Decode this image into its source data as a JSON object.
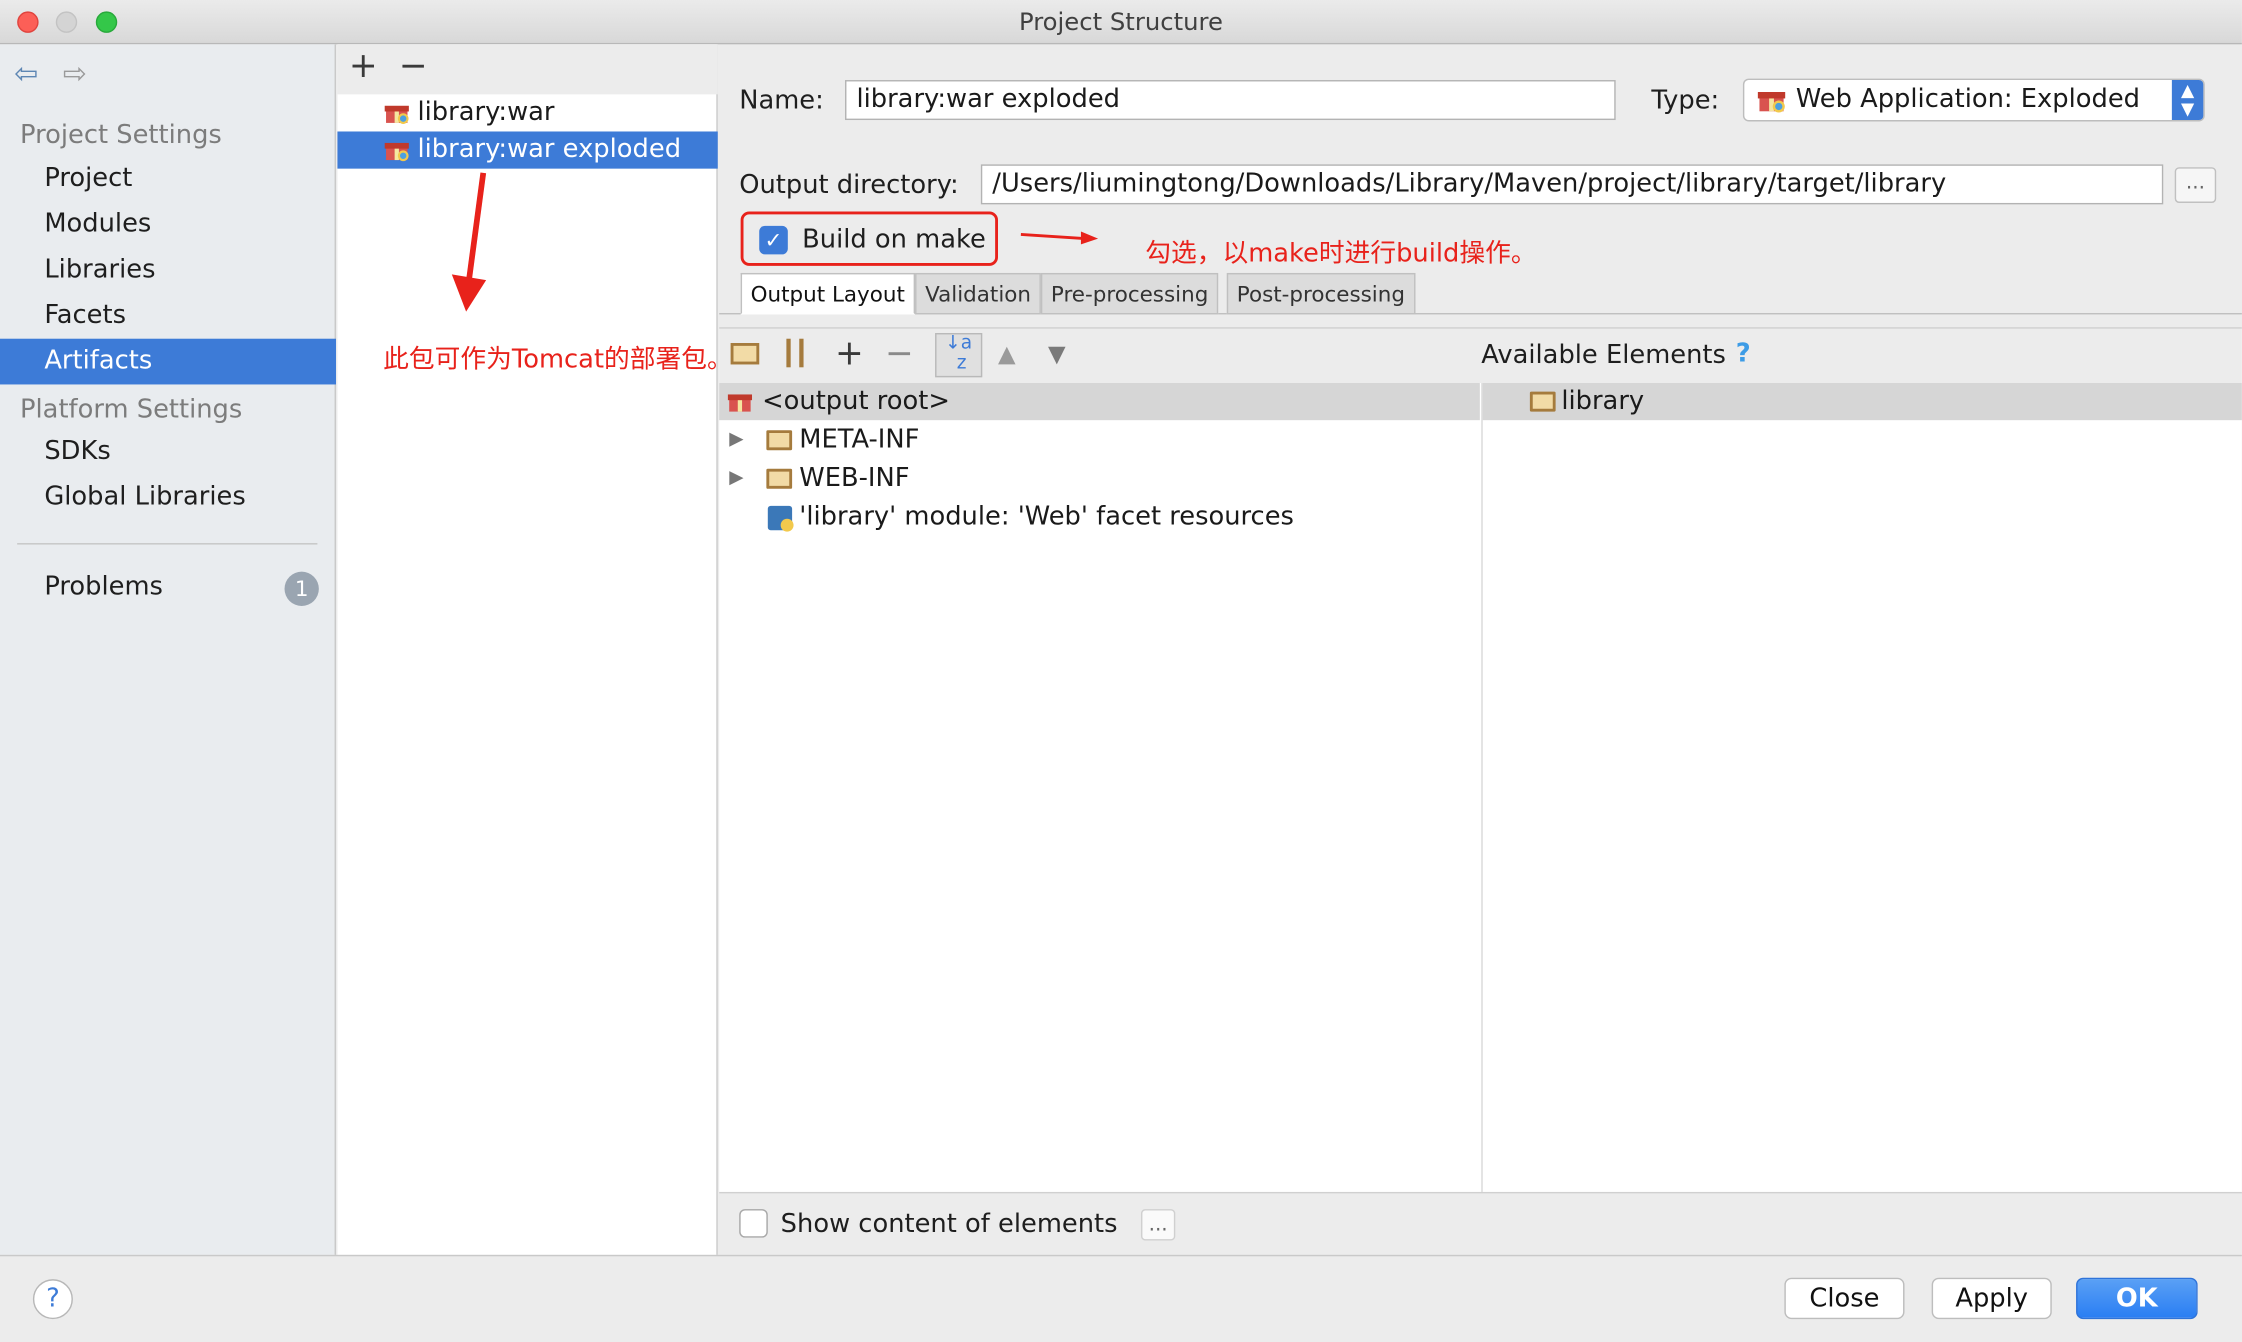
{
  "window": {
    "title": "Project Structure"
  },
  "sidebar": {
    "sections": [
      {
        "title": "Project Settings",
        "items": [
          "Project",
          "Modules",
          "Libraries",
          "Facets",
          "Artifacts"
        ]
      },
      {
        "title": "Platform Settings",
        "items": [
          "SDKs",
          "Global Libraries"
        ]
      }
    ],
    "selected": "Artifacts",
    "problems": {
      "label": "Problems",
      "count": "1"
    }
  },
  "artifacts": {
    "add_icon": "plus-icon",
    "remove_icon": "minus-icon",
    "items": [
      "library:war",
      "library:war exploded"
    ],
    "selected": "library:war exploded"
  },
  "form": {
    "name_label": "Name:",
    "name_value": "library:war exploded",
    "type_label": "Type:",
    "type_value": "Web Application: Exploded",
    "output_label": "Output directory:",
    "output_value": "/Users/liumingtong/Downloads/Library/Maven/project/library/target/library",
    "browse_label": "...",
    "build_on_make": {
      "label": "Build on make",
      "checked": true
    }
  },
  "annotations": {
    "build_note": "勾选，以make时进行build操作。",
    "deploy_note": "此包可作为Tomcat的部署包。"
  },
  "tabs": [
    "Output Layout",
    "Validation",
    "Pre-processing",
    "Post-processing"
  ],
  "active_tab": "Output Layout",
  "layout_tree": {
    "root": "<output root>",
    "children": [
      "META-INF",
      "WEB-INF",
      "'library' module: 'Web' facet resources"
    ]
  },
  "available": {
    "title": "Available Elements",
    "help": "?",
    "items": [
      "library"
    ]
  },
  "show_content": {
    "label": "Show content of elements",
    "checked": false,
    "dots": "..."
  },
  "footer": {
    "help": "?",
    "close": "Close",
    "apply": "Apply",
    "ok": "OK"
  },
  "colors": {
    "accent": "#3d7bd7",
    "annotation": "#e8221b"
  }
}
